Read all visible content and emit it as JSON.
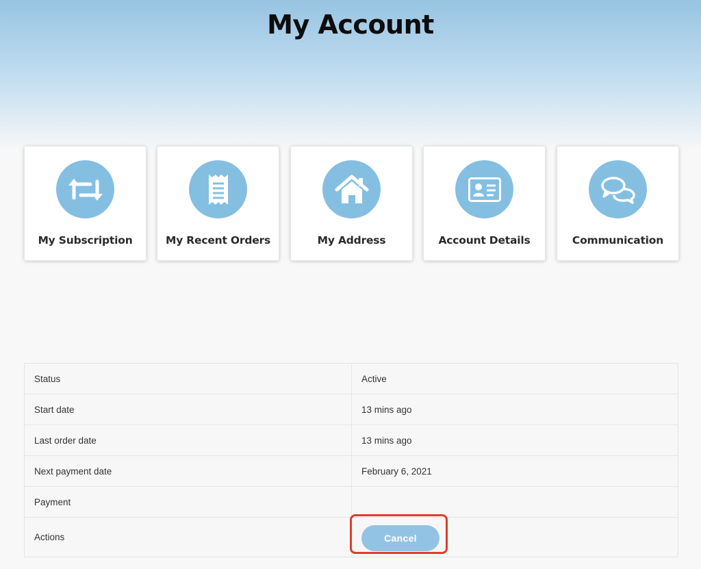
{
  "page": {
    "title": "My Account"
  },
  "tiles": [
    {
      "label": "My Subscription",
      "icon": "subscription-refresh-icon"
    },
    {
      "label": "My Recent Orders",
      "icon": "receipt-icon"
    },
    {
      "label": "My Address",
      "icon": "home-icon"
    },
    {
      "label": "Account Details",
      "icon": "id-card-icon"
    },
    {
      "label": "Communication",
      "icon": "chat-bubbles-icon"
    }
  ],
  "details": {
    "rows": [
      {
        "label": "Status",
        "value": "Active"
      },
      {
        "label": "Start date",
        "value": "13 mins ago"
      },
      {
        "label": "Last order date",
        "value": "13 mins ago"
      },
      {
        "label": "Next payment date",
        "value": "February 6, 2021"
      },
      {
        "label": "Payment",
        "value": ""
      },
      {
        "label": "Actions",
        "value": ""
      }
    ],
    "cancel_label": "Cancel"
  },
  "colors": {
    "icon_circle": "#84bfe2",
    "cancel_button": "#93c3e4",
    "highlight_border": "#e23b2e",
    "hero_top": "#97c4e2"
  }
}
